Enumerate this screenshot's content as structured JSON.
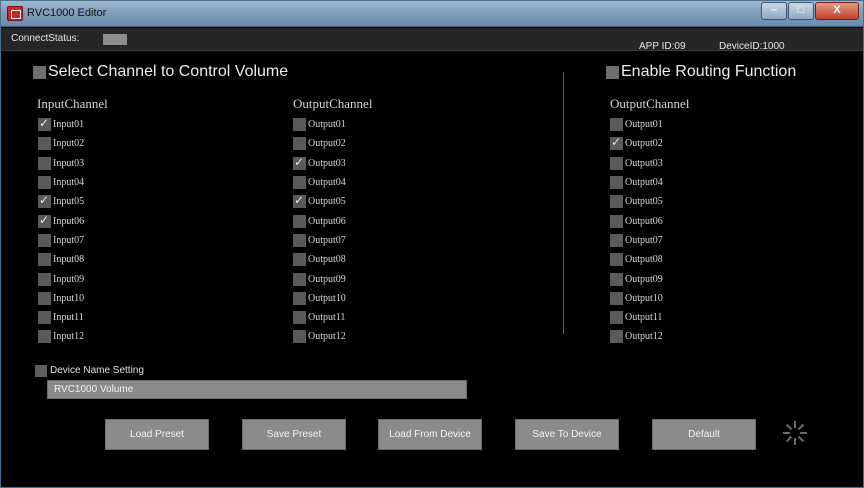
{
  "window": {
    "title": "RVC1000 Editor",
    "minimize_icon": "–",
    "maximize_icon": "□",
    "close_icon": "X"
  },
  "status": {
    "connect_label": "ConnectStatus:",
    "app_id": "APP ID:09",
    "device_id": "DeviceID:1000"
  },
  "volume": {
    "header": "Select Channel to Control Volume",
    "input_title": "InputChannel",
    "output_title": "OutputChannel",
    "inputs": [
      {
        "label": "Input01",
        "checked": true
      },
      {
        "label": "Input02",
        "checked": false
      },
      {
        "label": "Input03",
        "checked": false
      },
      {
        "label": "Input04",
        "checked": false
      },
      {
        "label": "Input05",
        "checked": true
      },
      {
        "label": "Input06",
        "checked": true
      },
      {
        "label": "Input07",
        "checked": false
      },
      {
        "label": "Input08",
        "checked": false
      },
      {
        "label": "Input09",
        "checked": false
      },
      {
        "label": "Input10",
        "checked": false
      },
      {
        "label": "Input11",
        "checked": false
      },
      {
        "label": "Input12",
        "checked": false
      }
    ],
    "outputs": [
      {
        "label": "Output01",
        "checked": false
      },
      {
        "label": "Output02",
        "checked": false
      },
      {
        "label": "Output03",
        "checked": true
      },
      {
        "label": "Output04",
        "checked": false
      },
      {
        "label": "Output05",
        "checked": true
      },
      {
        "label": "Output06",
        "checked": false
      },
      {
        "label": "Output07",
        "checked": false
      },
      {
        "label": "Output08",
        "checked": false
      },
      {
        "label": "Output09",
        "checked": false
      },
      {
        "label": "Output10",
        "checked": false
      },
      {
        "label": "Output11",
        "checked": false
      },
      {
        "label": "Output12",
        "checked": false
      }
    ]
  },
  "routing": {
    "header": "Enable Routing Function",
    "output_title": "OutputChannel",
    "outputs": [
      {
        "label": "Output01",
        "checked": false
      },
      {
        "label": "Output02",
        "checked": true
      },
      {
        "label": "Output03",
        "checked": false
      },
      {
        "label": "Output04",
        "checked": false
      },
      {
        "label": "Output05",
        "checked": false
      },
      {
        "label": "Output06",
        "checked": false
      },
      {
        "label": "Output07",
        "checked": false
      },
      {
        "label": "Output08",
        "checked": false
      },
      {
        "label": "Output09",
        "checked": false
      },
      {
        "label": "Output10",
        "checked": false
      },
      {
        "label": "Output11",
        "checked": false
      },
      {
        "label": "Output12",
        "checked": false
      }
    ]
  },
  "device_name": {
    "label": "Device Name Setting",
    "value": "RVC1000 Volume"
  },
  "buttons": {
    "load_preset": "Load Preset",
    "save_preset": "Save Preset",
    "load_from_device": "Load From Device",
    "save_to_device": "Save To Device",
    "default": "Default"
  },
  "icons": {
    "app": "app-logo-icon",
    "busy": "loading-spinner-icon"
  }
}
